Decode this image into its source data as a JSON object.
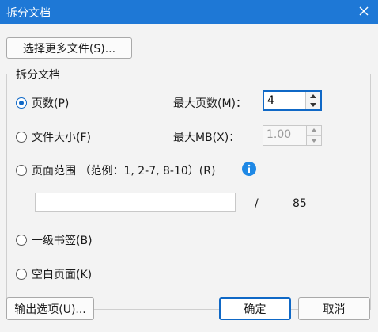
{
  "window": {
    "title": "拆分文档"
  },
  "buttons": {
    "select_more_files": "选择更多文件(S)...",
    "output_options": "输出选项(U)...",
    "ok": "确定",
    "cancel": "取消"
  },
  "group": {
    "title": "拆分文档",
    "options": [
      {
        "id": "pages",
        "label": "页数(P)",
        "checked": true
      },
      {
        "id": "file_size",
        "label": "文件大小(F)",
        "checked": false
      },
      {
        "id": "page_range",
        "label": "页面范围 （范例：1, 2-7, 8-10）(R)",
        "checked": false
      },
      {
        "id": "bookmark",
        "label": "一级书签(B)",
        "checked": false
      },
      {
        "id": "blank_page",
        "label": "空白页面(K)",
        "checked": false
      }
    ],
    "max_pages": {
      "label": "最大页数(M)：",
      "value": "4"
    },
    "max_mb": {
      "label": "最大MB(X)：",
      "value": "1.00"
    },
    "page_range_input": {
      "value": ""
    },
    "total_pages": {
      "separator": "/",
      "value": "85"
    }
  },
  "colors": {
    "title_bar": "#1e78d6",
    "accent": "#0f68c6",
    "info": "#1e88e5"
  },
  "icons": [
    "close-icon",
    "info-icon",
    "spin-up-icon",
    "spin-down-icon"
  ]
}
